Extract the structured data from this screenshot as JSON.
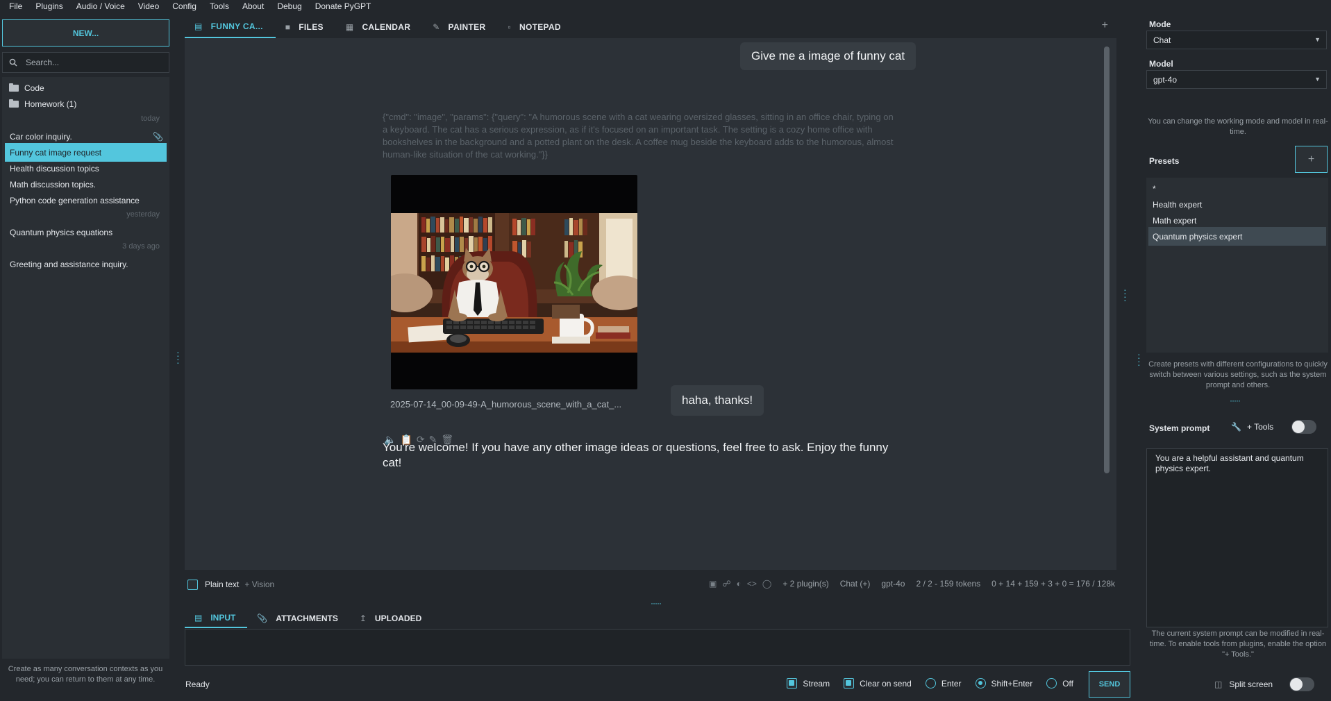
{
  "menu": [
    "File",
    "Plugins",
    "Audio / Voice",
    "Video",
    "Config",
    "Tools",
    "About",
    "Debug",
    "Donate PyGPT"
  ],
  "sidebar": {
    "new_label": "NEW...",
    "search_placeholder": "Search...",
    "folders": [
      "Code",
      "Homework (1)"
    ],
    "groups": {
      "today": "today",
      "yesterday": "yesterday",
      "three_days": "3 days ago"
    },
    "items": [
      "Car color inquiry.",
      "Funny cat image request",
      "Health discussion topics",
      "Math discussion topics.",
      "Python code generation assistance",
      "Quantum physics equations",
      "Greeting and assistance inquiry."
    ],
    "hint": "Create as many conversation contexts as you need; you can return to them at any time."
  },
  "tabs": [
    "FUNNY CA...",
    "FILES",
    "CALENDAR",
    "PAINTER",
    "NOTEPAD"
  ],
  "tab_add": "+",
  "chat": {
    "user_msg_1": "Give me a image of funny cat",
    "cmd": "{\"cmd\": \"image\", \"params\": {\"query\": \"A humorous scene with a cat wearing oversized glasses, sitting in an office chair, typing on a keyboard. The cat has a serious expression, as if it's focused on an important task. The setting is a cozy home office with bookshelves in the background and a potted plant on the desk. A coffee mug beside the keyboard adds to the humorous, almost human-like situation of the cat working.\"}}",
    "image_caption": "2025-07-14_00-09-49-A_humorous_scene_with_a_cat_...",
    "user_msg_2": "haha, thanks!",
    "reply": "You're welcome! If you have any other image ideas or questions, feel free to ask. Enjoy the funny cat!"
  },
  "strip": {
    "plain_text": "Plain text",
    "vision": "+ Vision",
    "plugins": "+ 2 plugin(s)",
    "mode": "Chat (+)",
    "model": "gpt-4o",
    "ctx_tokens": "2 / 2 - 159 tokens",
    "totals": "0 + 14 + 159 + 3 + 0 = 176 / 128k"
  },
  "input_tabs": [
    "INPUT",
    "ATTACHMENTS",
    "UPLOADED"
  ],
  "bottom": {
    "status": "Ready",
    "stream": "Stream",
    "clear_on_send": "Clear on send",
    "enter": "Enter",
    "shift_enter": "Shift+Enter",
    "off": "Off",
    "send": "SEND"
  },
  "right": {
    "mode_label": "Mode",
    "mode_value": "Chat",
    "model_label": "Model",
    "model_value": "gpt-4o",
    "mode_hint": "You can change the working mode and model in real-time.",
    "presets_label": "Presets",
    "preset_add": "+",
    "presets": [
      "*",
      "Health expert",
      "Math expert",
      "Quantum physics expert"
    ],
    "presets_hint": "Create presets with different configurations to quickly switch between various settings, such as the system prompt and others.",
    "system_prompt_label": "System prompt",
    "tools_label": "+ Tools",
    "system_prompt": "You are a helpful assistant and quantum physics expert.",
    "system_hint": "The current system prompt can be modified in real-time. To enable tools from plugins, enable the option \"+ Tools.\"",
    "split_screen": "Split screen"
  },
  "colors": {
    "accent": "#53c6dd",
    "background": "#23272c",
    "chat_bg": "#2c3137",
    "bubble": "#373d43"
  }
}
